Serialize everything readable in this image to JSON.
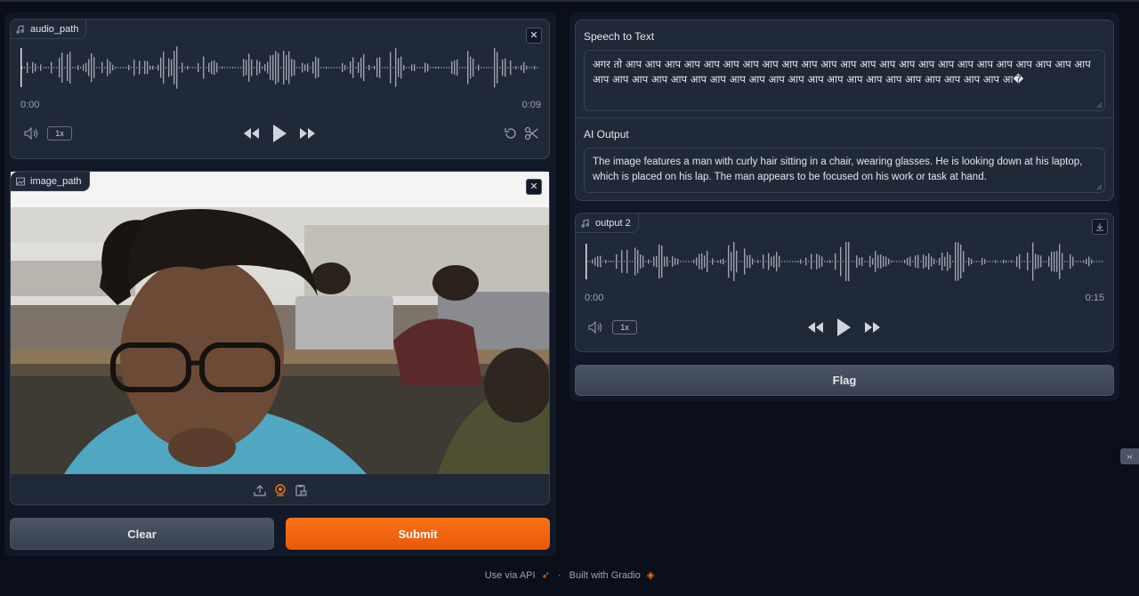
{
  "audio_input": {
    "label": "audio_path",
    "time_start": "0:00",
    "time_end": "0:09",
    "speed": "1x",
    "icons": [
      "music-icon",
      "close-icon",
      "volume-icon",
      "rewind-icon",
      "play-icon",
      "fast-forward-icon",
      "undo-icon",
      "scissors-icon"
    ]
  },
  "image_input": {
    "label": "image_path",
    "toolbar_icons": [
      "upload-icon",
      "webcam-icon",
      "clipboard-icon"
    ]
  },
  "buttons": {
    "clear": "Clear",
    "submit": "Submit",
    "flag": "Flag"
  },
  "speech_to_text": {
    "label": "Speech to Text",
    "value": "अगर तो आप आप आप आप आप आप आप आप आप आप आप आप आप आप आप आप आप आप आप आप आप आप आप आप आप आप आप आप आप आप आप आप आप आप आप आप आप आप आप आप आप आप आप आप आप आ�"
  },
  "ai_output": {
    "label": "AI Output",
    "value": "The image features a man with curly hair sitting in a chair, wearing glasses. He is looking down at his laptop, which is placed on his lap. The man appears to be focused on his work or task at hand."
  },
  "audio_output": {
    "label": "output 2",
    "time_start": "0:00",
    "time_end": "0:15",
    "speed": "1x"
  },
  "footer": {
    "api_link": "Use via API",
    "separator": "·",
    "built_with": "Built with Gradio"
  },
  "colors": {
    "background": "#0b0f19",
    "panel": "#1f2937",
    "accent": "#f97316"
  }
}
